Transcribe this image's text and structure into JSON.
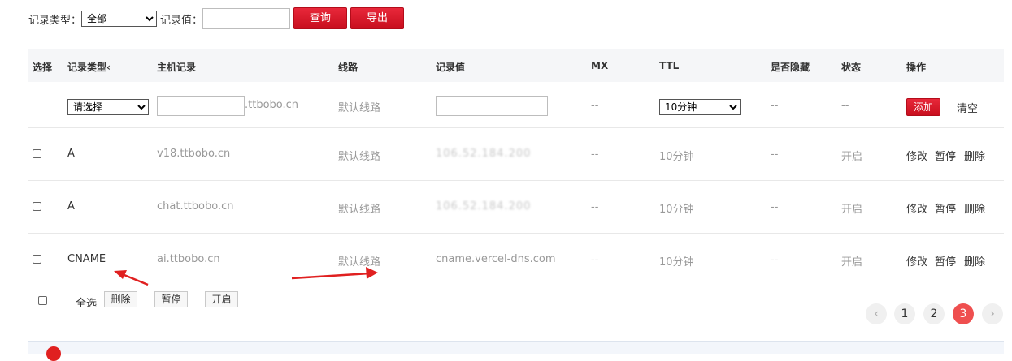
{
  "filter": {
    "record_type_label": "记录类型：",
    "record_type_value": "全部",
    "record_value_label": "记录值：",
    "record_value_input": "",
    "query_button": "查询",
    "export_button": "导出"
  },
  "table": {
    "headers": {
      "select": "选择",
      "record_type": "记录类型‹",
      "host": "主机记录",
      "line": "线路",
      "value": "记录值",
      "mx": "MX",
      "ttl": "TTL",
      "hidden": "是否隐藏",
      "status": "状态",
      "actions": "操作"
    },
    "new_row": {
      "type_select": "请选择",
      "host_suffix": ".ttbobo.cn",
      "line": "默认线路",
      "mx": "--",
      "ttl_select": "10分钟",
      "hidden": "--",
      "status": "--",
      "add_button": "添加",
      "clear_button": "清空"
    },
    "rows": [
      {
        "type": "A",
        "host": "v18.ttbobo.cn",
        "line": "默认线路",
        "value": "106.52.184.200",
        "mx": "--",
        "ttl": "10分钟",
        "hidden": "--",
        "status": "开启",
        "edit": "修改",
        "pause": "暂停",
        "delete": "删除"
      },
      {
        "type": "A",
        "host": "chat.ttbobo.cn",
        "line": "默认线路",
        "value": "106.52.184.200",
        "mx": "--",
        "ttl": "10分钟",
        "hidden": "--",
        "status": "开启",
        "edit": "修改",
        "pause": "暂停",
        "delete": "删除"
      },
      {
        "type": "CNAME",
        "host": "ai.ttbobo.cn",
        "line": "默认线路",
        "value": "cname.vercel-dns.com",
        "mx": "--",
        "ttl": "10分钟",
        "hidden": "--",
        "status": "开启",
        "edit": "修改",
        "pause": "暂停",
        "delete": "删除"
      }
    ]
  },
  "bulk": {
    "select_all": "全选",
    "delete": "删除",
    "pause": "暂停",
    "enable": "开启"
  },
  "pagination": {
    "prev": "‹",
    "pages": [
      "1",
      "2",
      "3"
    ],
    "current": "3",
    "next": "›"
  },
  "colors": {
    "accent": "#d6121f",
    "page_active": "#ef4f4f",
    "arrow": "#e02020",
    "tip_icon": "#e02020"
  }
}
